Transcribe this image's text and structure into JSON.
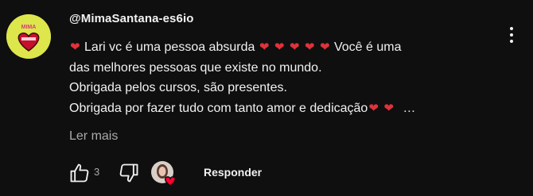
{
  "comment": {
    "author": "@MimaSantana-es6io",
    "lines": [
      [
        "",
        "Lari vc é uma pessoa absurda",
        "",
        "Você é uma"
      ],
      "das melhores pessoas que existe no mundo.",
      "Obrigada pelos cursos, são presentes.",
      "Obrigada por fazer tudo com tanto amor e dedicação"
    ],
    "line1_start": "Lari vc é uma pessoa absurda",
    "line1_end": "Você é uma",
    "line2": "das melhores pessoas que existe no mundo.",
    "line3": "Obrigada pelos cursos, são presentes.",
    "line4": "Obrigada por fazer tudo com tanto amor e dedicação",
    "ellipsis": "…",
    "heart": "❤",
    "avatar_text": "MIMA"
  },
  "read_more": "Ler mais",
  "actions": {
    "like_count": "3",
    "reply_label": "Responder"
  },
  "colors": {
    "background": "#0f0f0f",
    "text": "#f1f1f1",
    "secondary": "#aaaaaa",
    "heart": "#e0323a",
    "avatar_bg": "#dde64b"
  }
}
